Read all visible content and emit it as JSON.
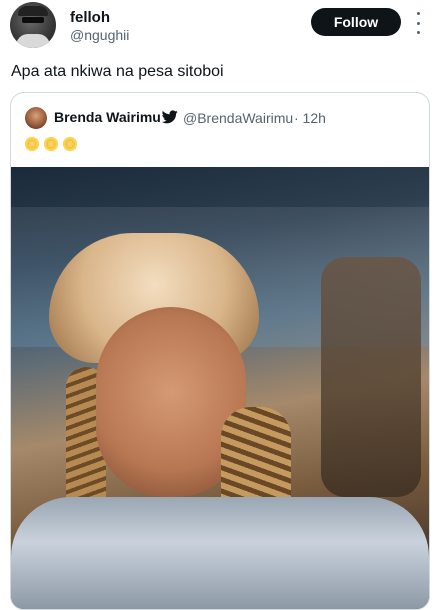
{
  "author": {
    "name": "felloh",
    "handle": "@ngughii",
    "avatar_icon": "user-avatar"
  },
  "actions": {
    "follow_label": "Follow",
    "more_icon": "more-vertical-icon"
  },
  "tweet": {
    "text": "Apa ata nkiwa na pesa sitoboi"
  },
  "quoted": {
    "name": "Brenda Wairimu",
    "verified_icon": "twitter-bird-icon",
    "handle": "@BrendaWairimu",
    "time": "· 12h",
    "emojis": [
      "sun",
      "sun",
      "sun"
    ],
    "photo_icon": "selfie-photo"
  },
  "colors": {
    "text": "#0f1419",
    "secondary": "#536471",
    "button": "#0f1419",
    "border": "#cfd9de"
  }
}
